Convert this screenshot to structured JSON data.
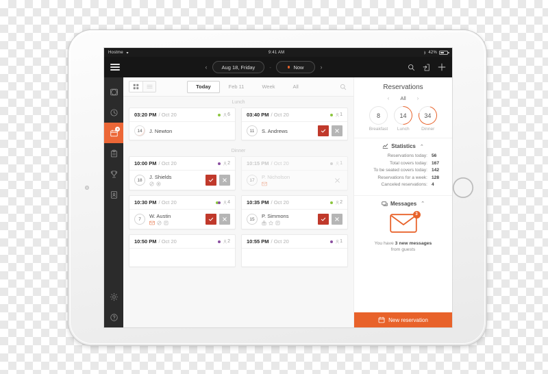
{
  "status_bar": {
    "carrier": "Hostme",
    "time": "9:41 AM",
    "battery_pct": "42%"
  },
  "topbar": {
    "menu_icon": "hamburger-icon",
    "prev_arrow": "‹",
    "date_label": "Aug 18, Friday",
    "separator": "-",
    "now_label": "Now",
    "next_arrow": "›",
    "icons": [
      "search-icon",
      "import-icon",
      "plus-icon"
    ]
  },
  "sidebar": {
    "items": [
      {
        "name": "tables",
        "icon": "table-layout-icon",
        "active": false,
        "badge": ""
      },
      {
        "name": "waitlist",
        "icon": "clock-icon",
        "active": false,
        "badge": ""
      },
      {
        "name": "reservations",
        "icon": "calendar-icon",
        "active": true,
        "badge": "3"
      },
      {
        "name": "orders",
        "icon": "clipboard-icon",
        "active": false,
        "badge": ""
      },
      {
        "name": "rewards",
        "icon": "trophy-icon",
        "active": false,
        "badge": ""
      },
      {
        "name": "guests",
        "icon": "contacts-icon",
        "active": false,
        "badge": ""
      }
    ],
    "bottom_items": [
      {
        "name": "settings",
        "icon": "gear-icon"
      },
      {
        "name": "help",
        "icon": "help-icon"
      }
    ]
  },
  "toolbar": {
    "grid_view_icon": "grid-view-icon",
    "list_view_icon": "list-view-icon",
    "tabs": [
      {
        "label": "Today",
        "active": true
      },
      {
        "label": "Feb 11",
        "active": false
      },
      {
        "label": "Week",
        "active": false
      },
      {
        "label": "All",
        "active": false
      }
    ],
    "search_icon": "search-icon"
  },
  "reservation_list": {
    "sections": [
      {
        "divider": "Lunch",
        "rows": [
          {
            "cards": [
              {
                "time": "03:20 PM",
                "date": "/ Oct 20",
                "dot_color": "#8cc63f",
                "dot_style": "single",
                "party_icon": "person-icon",
                "party_size": "6",
                "table": "14",
                "guest": "J. Newton",
                "guest_icons": [],
                "actions": [],
                "muted": false,
                "table_ring": true
              },
              {
                "time": "03:40 PM",
                "date": "/ Oct 20",
                "dot_color": "#8cc63f",
                "dot_style": "single",
                "party_icon": "person-icon",
                "party_size": "1",
                "table": "11",
                "guest": "S. Andrews",
                "guest_icons": [],
                "actions": [
                  "confirm",
                  "cancel"
                ],
                "muted": false,
                "table_ring": false
              }
            ]
          }
        ]
      },
      {
        "divider": "Dinner",
        "rows": [
          {
            "cards": [
              {
                "time": "10:00 PM",
                "date": "/ Oct 20",
                "dot_color": "#8a4fa0",
                "dot_style": "single",
                "party_icon": "person-icon",
                "party_size": "2",
                "table": "18",
                "guest": "J. Shields",
                "guest_icons": [
                  "no-entry-icon",
                  "allergy-icon"
                ],
                "actions": [
                  "confirm",
                  "cancel"
                ],
                "muted": false,
                "table_ring": false
              },
              {
                "time": "10:15 PM",
                "date": "/ Oct 20",
                "dot_color": "#b9b9b9",
                "dot_style": "single",
                "party_icon": "person-icon",
                "party_size": "1",
                "table": "17",
                "guest": "P. Nicholson",
                "guest_icons": [
                  "envelope-icon"
                ],
                "actions": [
                  "plain-cancel"
                ],
                "muted": true,
                "table_ring": false
              }
            ]
          },
          {
            "cards": [
              {
                "time": "10:30 PM",
                "date": "/ Oct 20",
                "dot_color": "#8cc63f",
                "dot_style": "double",
                "party_icon": "person-icon",
                "party_size": "4",
                "table": "7",
                "guest": "W. Austin",
                "guest_icons": [
                  "envelope-icon",
                  "no-entry-icon",
                  "note-icon"
                ],
                "actions": [
                  "confirm",
                  "cancel"
                ],
                "muted": false,
                "table_ring": false
              },
              {
                "time": "10:35 PM",
                "date": "/ Oct 20",
                "dot_color": "#8cc63f",
                "dot_style": "single",
                "party_icon": "person-icon",
                "party_size": "2",
                "table": "15",
                "guest": "P. Simmons",
                "guest_icons": [
                  "gift-icon",
                  "star-icon",
                  "note-icon"
                ],
                "actions": [
                  "confirm",
                  "cancel"
                ],
                "muted": false,
                "table_ring": false
              }
            ]
          },
          {
            "cards": [
              {
                "time": "10:50 PM",
                "date": "/ Oct 20",
                "dot_color": "#8a4fa0",
                "dot_style": "single",
                "party_icon": "person-icon",
                "party_size": "2",
                "table": "",
                "guest": "",
                "guest_icons": [],
                "actions": [],
                "muted": false,
                "table_ring": false
              },
              {
                "time": "10:55 PM",
                "date": "/ Oct 20",
                "dot_color": "#8a4fa0",
                "dot_style": "single",
                "party_icon": "person-icon",
                "party_size": "1",
                "table": "",
                "guest": "",
                "guest_icons": [],
                "actions": [],
                "muted": false,
                "table_ring": false
              }
            ]
          }
        ]
      }
    ]
  },
  "right_panel": {
    "title": "Reservations",
    "filter": {
      "prev": "‹",
      "value": "All",
      "next": "›"
    },
    "meal_circles": [
      {
        "value": "8",
        "label": "Breakfast"
      },
      {
        "value": "14",
        "label": "Lunch"
      },
      {
        "value": "34",
        "label": "Dinner"
      }
    ],
    "statistics": {
      "icon": "chart-icon",
      "title": "Statistics",
      "chevron": "⌃",
      "lines": [
        {
          "label": "Reservations today:",
          "value": "56"
        },
        {
          "label": "Total covers today:",
          "value": "167"
        },
        {
          "label": "To be seated covers today:",
          "value": "142"
        },
        {
          "label": "Reservations for a week:",
          "value": "128"
        },
        {
          "label": "Canceled reservations:",
          "value": "4"
        }
      ]
    },
    "messages": {
      "icon": "messages-icon",
      "title": "Messages",
      "chevron": "⌃",
      "badge": "3",
      "text_prefix": "You have ",
      "text_bold": "3 new messages",
      "text_suffix": "from guests"
    },
    "new_reservation": {
      "icon": "calendar-plus-icon",
      "label": "New reservation"
    }
  },
  "colors": {
    "accent": "#e8622a",
    "confirm": "#c0392b",
    "cancel": "#b5b5b5",
    "green": "#8cc63f",
    "purple": "#8a4fa0",
    "dark": "#161616"
  }
}
